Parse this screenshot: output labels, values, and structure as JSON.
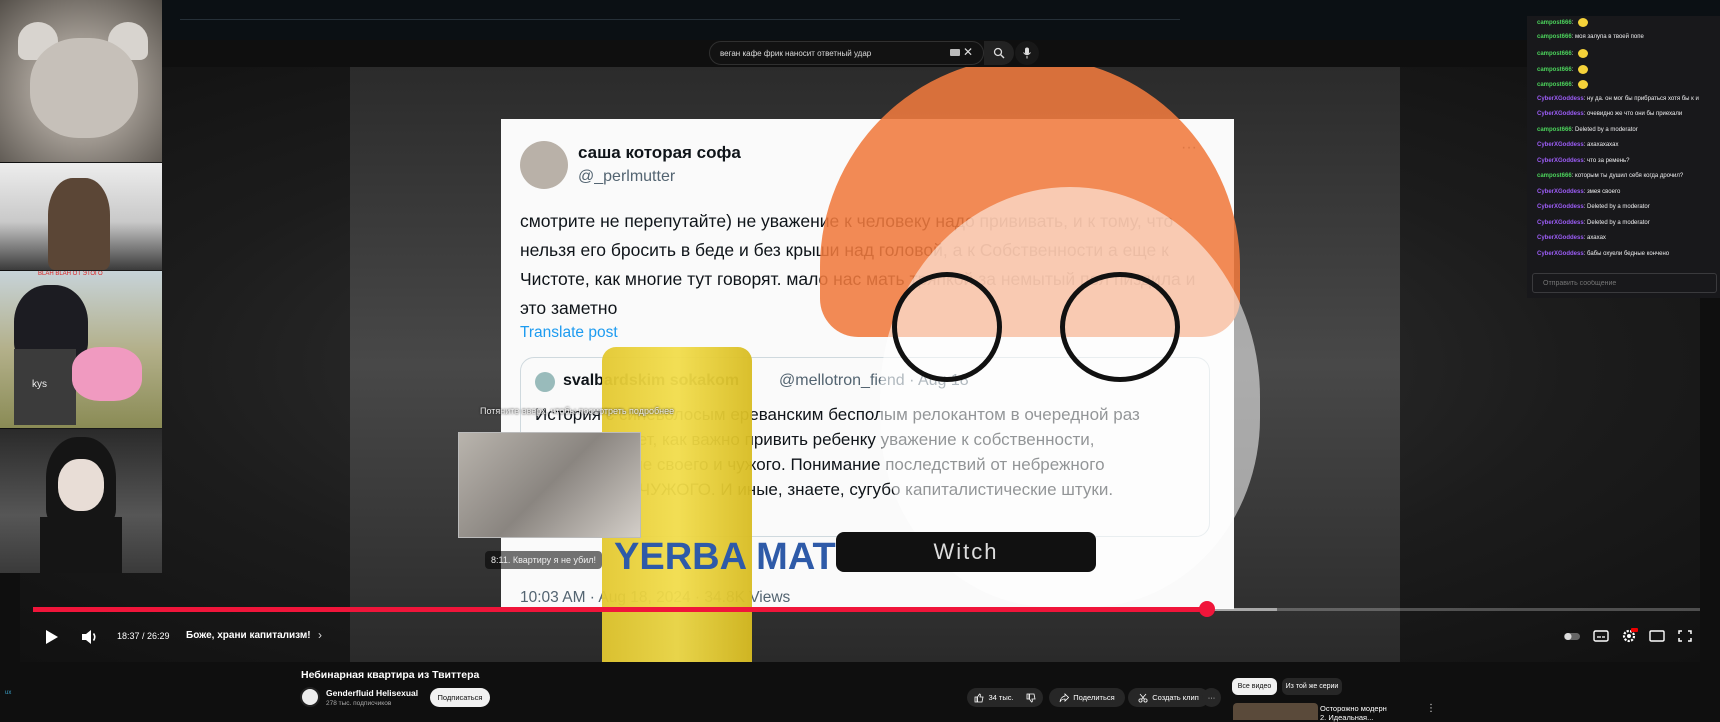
{
  "search": {
    "query": "веган кафе фрик наносит ответный удар"
  },
  "tweet": {
    "name": "саша которая софа",
    "handle": "@_perlmutter",
    "more": "···",
    "text": "смотрите не перепутайте) не уважение к человеку надо прививать, и к тому, что нельзя его бросить в беде и без крыши над головой, а к Собственности а еще к Чистоте, как многие тут говорят. мало нас мать тряпкой за немытый пол пиздила и это заметно",
    "translate": "Translate post",
    "quote_name": "svalbardskim sokakom",
    "quote_handle": "@mellotron_fiend · Aug 18",
    "quote_text": "История с синеволосым ереванским бесполым релокантом в очередной раз демонстрирует, как важно привить ребенку уважение к собственности, разграничение своего и чужого. Понимание последствий от небрежного отношения к ЧУЖОГО. И иные, знаете, сугубо капиталистические штуки.",
    "time": "10:03 AM · Aug 18, 2024 · 34.8K Views"
  },
  "overlay": {
    "collar_text": "Witch",
    "can_text": "YERBA MATE"
  },
  "player": {
    "preview_title": "Потяните вверх, чтобы посмотреть подробнее",
    "preview_chapter": "8:11. Квартиру я не убил!",
    "time": "18:37 / 26:29",
    "chapter_title": "Боже, храни капитализм!",
    "progress": 0.704,
    "buffered": 0.746
  },
  "video": {
    "title": "Небинарная квартира из Твиттера",
    "channel": "Genderfluid Helisexual",
    "subs": "278 тыс. подписчиков",
    "subscribe": "Подписаться",
    "likes": "34 тыс.",
    "share": "Поделиться",
    "clip": "Создать клип"
  },
  "sidebar": {
    "chip_all": "Все видео",
    "chip_series": "Из той же серии",
    "rec_title": "Осторожно модерн 2. Идеальная... "
  },
  "webcams": {
    "cam3_label": "kys",
    "cam3_redtext": "BLAH BLAH ОТ ЭТОГО"
  },
  "left_label": "ux",
  "chat": {
    "messages": [
      {
        "user": "campost666",
        "color": "green",
        "text": "",
        "emote": true
      },
      {
        "user": "campost666",
        "color": "green",
        "text": "моя залупа в твоей попе",
        "emote": false
      },
      {
        "user": "campost666",
        "color": "green",
        "text": "",
        "emote": true
      },
      {
        "user": "campost666",
        "color": "green",
        "text": "",
        "emote": true
      },
      {
        "user": "campost666",
        "color": "green",
        "text": "",
        "emote": true
      },
      {
        "user": "CyberXGoddess",
        "color": "purple",
        "text": "ну да. он мог бы прибраться хотя бы к и",
        "emote": false
      },
      {
        "user": "CyberXGoddess",
        "color": "purple",
        "text": "очевидно же что они бы приехали",
        "emote": false
      },
      {
        "user": "campost666",
        "color": "green",
        "text": "Deleted by a moderator",
        "emote": false
      },
      {
        "user": "CyberXGoddess",
        "color": "purple",
        "text": "ахахахахах",
        "emote": false
      },
      {
        "user": "CyberXGoddess",
        "color": "purple",
        "text": "что за ремень?",
        "emote": false
      },
      {
        "user": "campost666",
        "color": "green",
        "text": "которым ты душил себя когда дрочил?",
        "emote": false
      },
      {
        "user": "CyberXGoddess",
        "color": "purple",
        "text": "змея своего",
        "emote": false
      },
      {
        "user": "CyberXGoddess",
        "color": "purple",
        "text": "Deleted by a moderator",
        "emote": false
      },
      {
        "user": "CyberXGoddess",
        "color": "purple",
        "text": "Deleted by a moderator",
        "emote": false
      },
      {
        "user": "CyberXGoddess",
        "color": "purple",
        "text": "ахахах",
        "emote": false
      },
      {
        "user": "CyberXGoddess",
        "color": "purple",
        "text": "бабы охуели бедные кончено",
        "emote": false
      }
    ],
    "input_placeholder": "Отправить сообщение"
  }
}
